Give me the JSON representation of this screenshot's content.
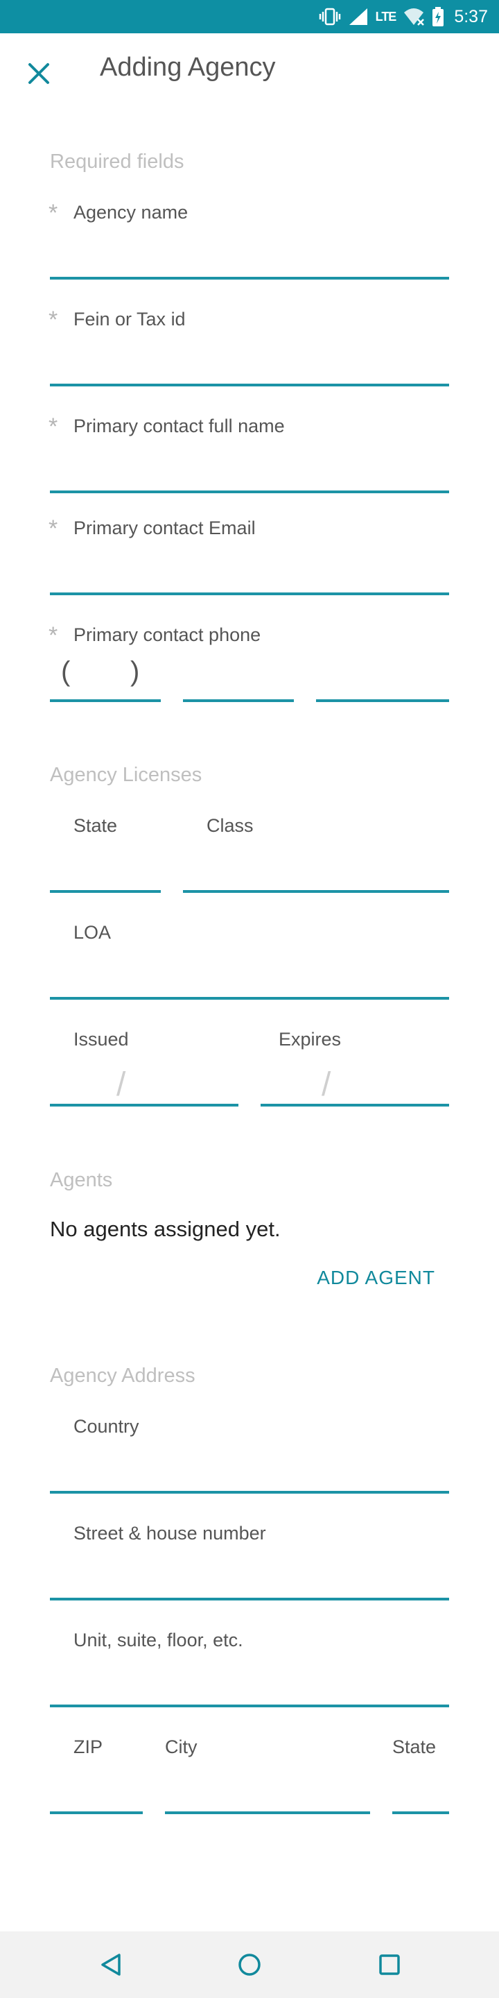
{
  "status_bar": {
    "time": "5:37",
    "network": "LTE",
    "icons": [
      "vibrate-icon",
      "signal-icon",
      "wifi-icon",
      "battery-charging-icon"
    ],
    "color": "#0e8fa3"
  },
  "app_bar": {
    "title": "Adding Agency",
    "close_icon": "close-icon"
  },
  "required": {
    "section_title": "Required fields",
    "star": "*",
    "agency_name_label": "Agency name",
    "fein_label": "Fein or Tax id",
    "contact_name_label": "Primary contact full name",
    "contact_email_label": "Primary contact Email",
    "contact_phone_label": "Primary contact phone",
    "phone_open_paren": "(",
    "phone_close_paren": ")"
  },
  "licenses": {
    "section_title": "Agency Licenses",
    "state_label": "State",
    "class_label": "Class",
    "loa_label": "LOA",
    "issued_label": "Issued",
    "expires_label": "Expires",
    "date_separator": "/"
  },
  "agents": {
    "section_title": "Agents",
    "empty_text": "No agents assigned yet.",
    "add_button": "ADD AGENT"
  },
  "address": {
    "section_title": "Agency Address",
    "country_label": "Country",
    "street_label": "Street & house number",
    "unit_label": "Unit, suite, floor, etc.",
    "zip_label": "ZIP",
    "city_label": "City",
    "state_label": "State"
  },
  "nav_bar": {
    "icons": [
      "back-icon",
      "home-icon",
      "recents-icon"
    ]
  },
  "colors": {
    "accent": "#1c93a6",
    "section_title": "#bfbfbf",
    "label": "#555555"
  }
}
